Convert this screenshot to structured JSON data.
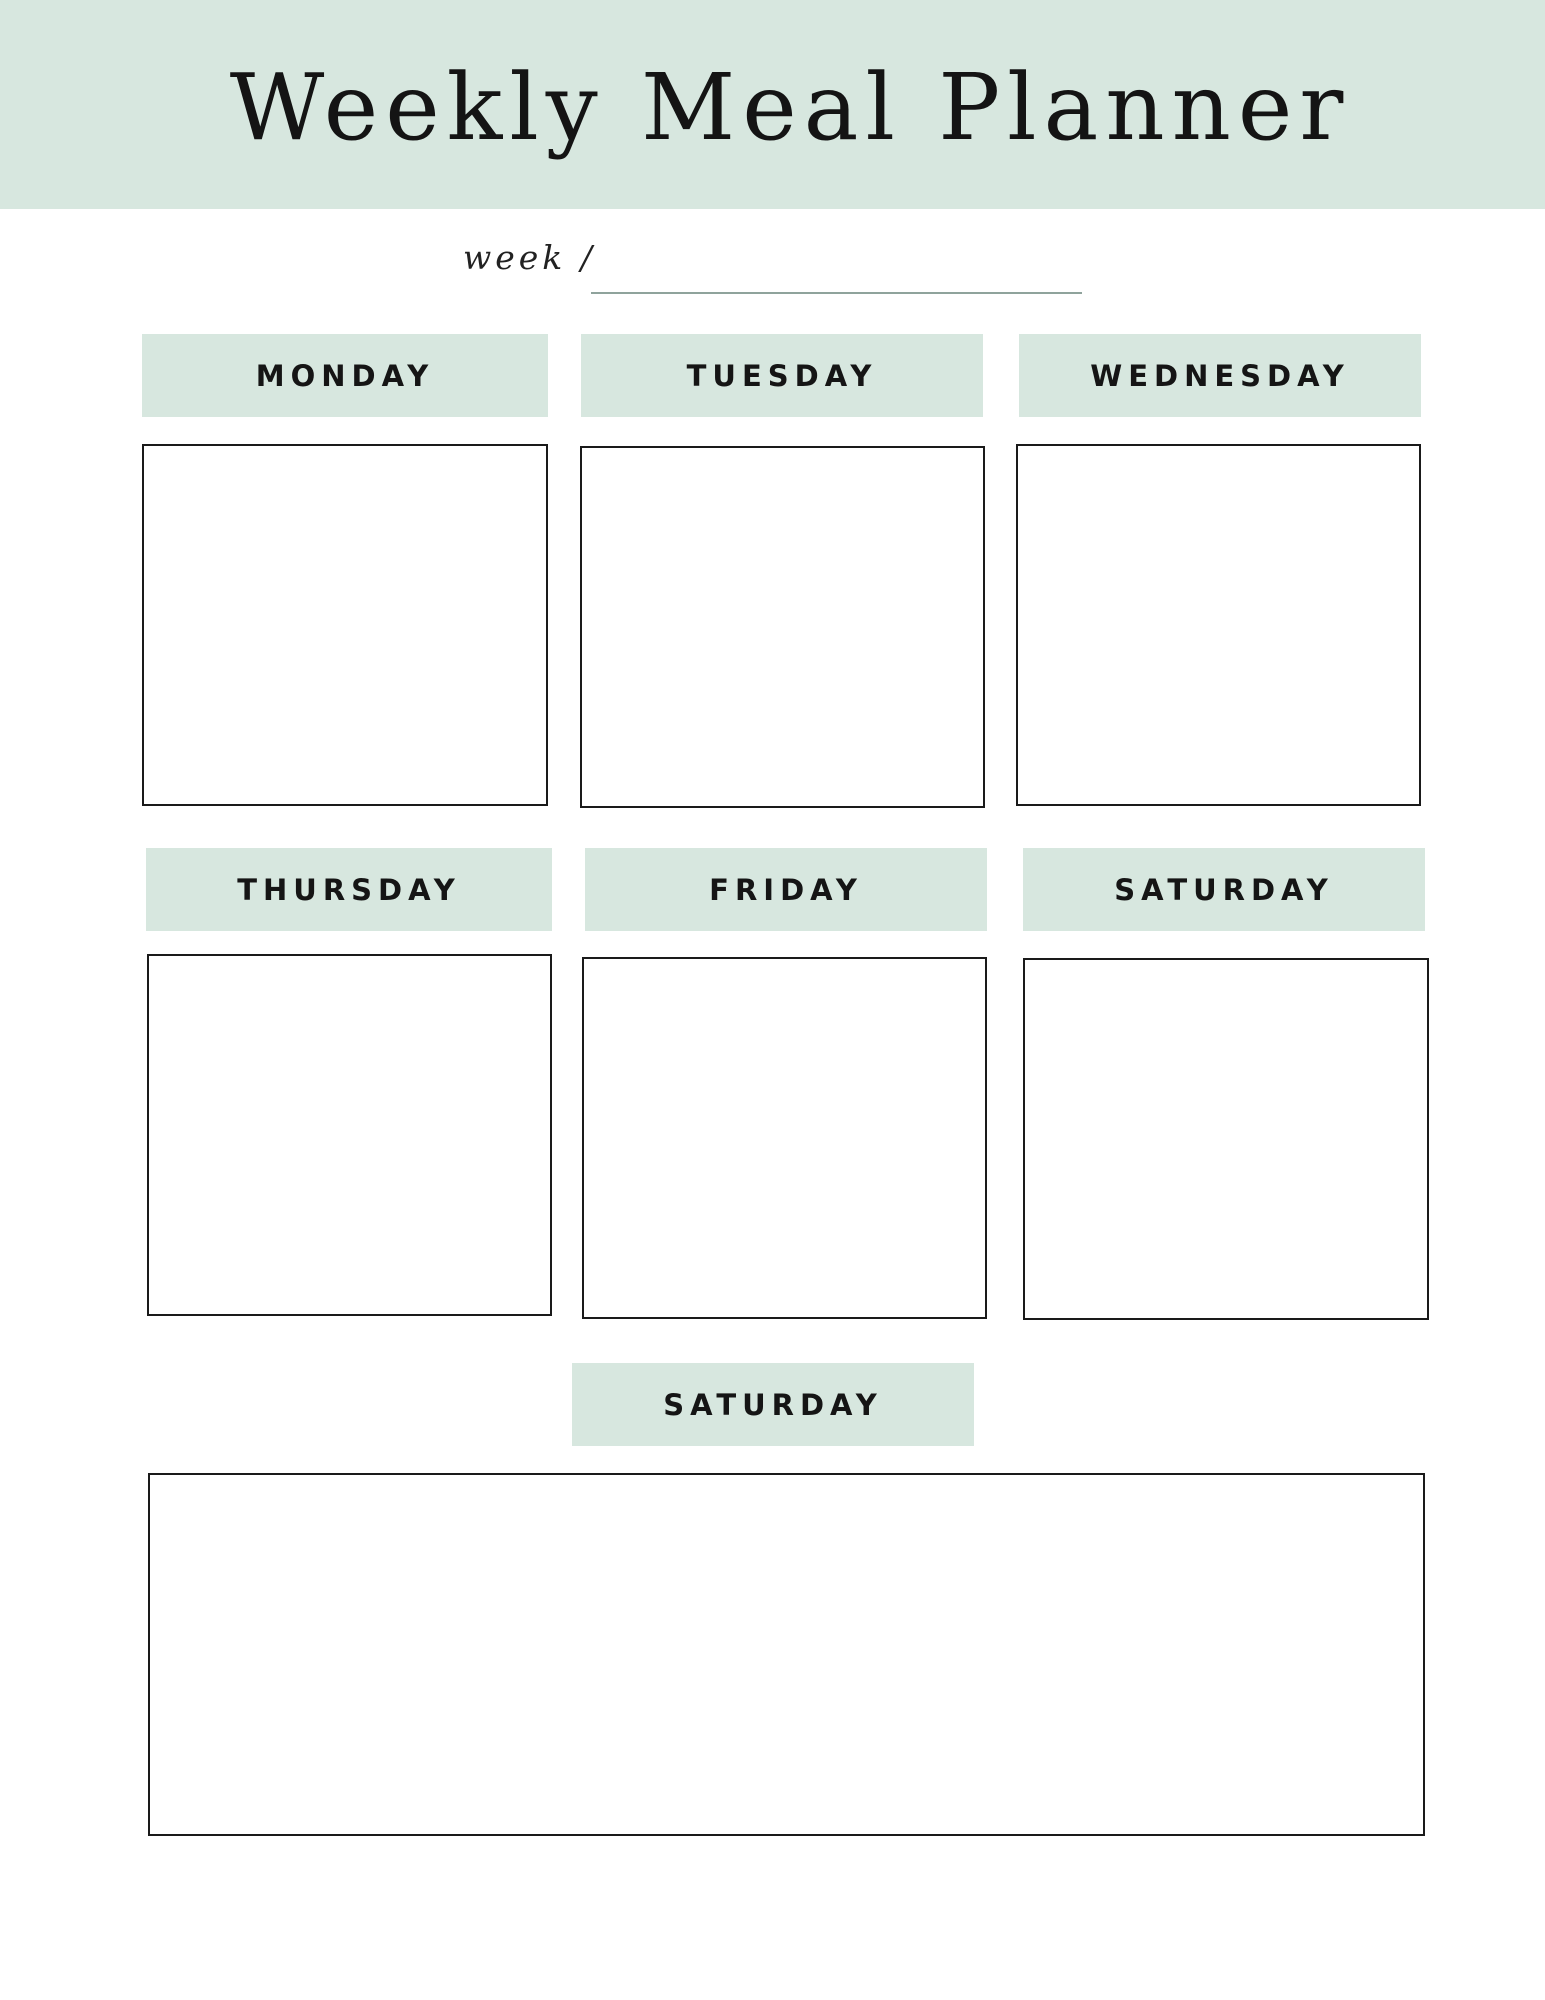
{
  "header": {
    "title": "Weekly Meal Planner",
    "background_color": "#d7e7df"
  },
  "week": {
    "label": "week /",
    "value": ""
  },
  "days": [
    {
      "label": "MONDAY"
    },
    {
      "label": "TUESDAY"
    },
    {
      "label": "WEDNESDAY"
    },
    {
      "label": "THURSDAY"
    },
    {
      "label": "FRIDAY"
    },
    {
      "label": "SATURDAY"
    },
    {
      "label": "SATURDAY"
    }
  ],
  "colors": {
    "accent": "#d7e7df",
    "text": "#151515",
    "border": "#1a1a1a"
  }
}
